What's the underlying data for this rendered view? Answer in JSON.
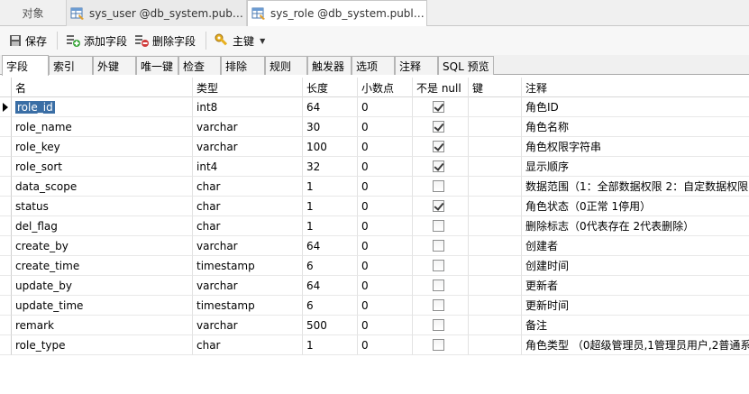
{
  "doc_tabs": {
    "objects_label": "对象",
    "tab1_label": "sys_user @db_system.public...",
    "tab2_label": "sys_role @db_system.public..."
  },
  "toolbar": {
    "save_label": "保存",
    "add_field_label": "添加字段",
    "delete_field_label": "删除字段",
    "primary_key_label": "主键"
  },
  "sub_tabs": [
    {
      "label": "字段",
      "active": true
    },
    {
      "label": "索引"
    },
    {
      "label": "外键"
    },
    {
      "label": "唯一键"
    },
    {
      "label": "检查"
    },
    {
      "label": "排除"
    },
    {
      "label": "规则"
    },
    {
      "label": "触发器"
    },
    {
      "label": "选项"
    },
    {
      "label": "注释"
    },
    {
      "label": "SQL 预览"
    }
  ],
  "columns": {
    "name": "名",
    "type": "类型",
    "length": "长度",
    "decimals": "小数点",
    "not_null": "不是 null",
    "key": "键",
    "comment": "注释"
  },
  "rows": [
    {
      "name": "role_id",
      "type": "int8",
      "length": "64",
      "decimals": "0",
      "not_null": true,
      "comment": "角色ID",
      "selected": true
    },
    {
      "name": "role_name",
      "type": "varchar",
      "length": "30",
      "decimals": "0",
      "not_null": true,
      "comment": "角色名称"
    },
    {
      "name": "role_key",
      "type": "varchar",
      "length": "100",
      "decimals": "0",
      "not_null": true,
      "comment": "角色权限字符串"
    },
    {
      "name": "role_sort",
      "type": "int4",
      "length": "32",
      "decimals": "0",
      "not_null": true,
      "comment": "显示顺序"
    },
    {
      "name": "data_scope",
      "type": "char",
      "length": "1",
      "decimals": "0",
      "not_null": false,
      "comment": "数据范围（1：全部数据权限 2：自定数据权限"
    },
    {
      "name": "status",
      "type": "char",
      "length": "1",
      "decimals": "0",
      "not_null": true,
      "comment": "角色状态（0正常 1停用）"
    },
    {
      "name": "del_flag",
      "type": "char",
      "length": "1",
      "decimals": "0",
      "not_null": false,
      "comment": "删除标志（0代表存在 2代表删除）"
    },
    {
      "name": "create_by",
      "type": "varchar",
      "length": "64",
      "decimals": "0",
      "not_null": false,
      "comment": "创建者"
    },
    {
      "name": "create_time",
      "type": "timestamp",
      "length": "6",
      "decimals": "0",
      "not_null": false,
      "comment": "创建时间"
    },
    {
      "name": "update_by",
      "type": "varchar",
      "length": "64",
      "decimals": "0",
      "not_null": false,
      "comment": "更新者"
    },
    {
      "name": "update_time",
      "type": "timestamp",
      "length": "6",
      "decimals": "0",
      "not_null": false,
      "comment": "更新时间"
    },
    {
      "name": "remark",
      "type": "varchar",
      "length": "500",
      "decimals": "0",
      "not_null": false,
      "comment": "备注"
    },
    {
      "name": "role_type",
      "type": "char",
      "length": "1",
      "decimals": "0",
      "not_null": false,
      "comment": "角色类型 （0超级管理员,1管理员用户,2普通系"
    }
  ]
}
